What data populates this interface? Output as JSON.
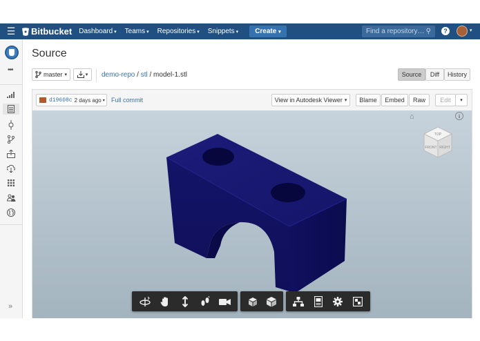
{
  "topnav": {
    "brand": "Bitbucket",
    "menus": [
      "Dashboard",
      "Teams",
      "Repositories",
      "Snippets"
    ],
    "create_label": "Create",
    "search_placeholder": "Find a repository…",
    "help_label": "?"
  },
  "sidebar": {
    "more_label": "•••",
    "collapse_label": "»"
  },
  "page": {
    "title": "Source"
  },
  "branch": {
    "label": "master"
  },
  "breadcrumb": {
    "repo": "demo-repo",
    "separator": " / ",
    "folder": "stl",
    "file": "model-1.stl"
  },
  "view_tabs": [
    "Source",
    "Diff",
    "History"
  ],
  "file_header": {
    "commit_hash": "d19608c",
    "commit_age": "2 days ago",
    "full_commit_label": "Full commit",
    "viewer_select": "View in Autodesk Viewer",
    "actions": [
      "Blame",
      "Embed",
      "Raw"
    ],
    "edit_label": "Edit"
  },
  "viewer": {
    "info_label": "i",
    "viewcube_faces": [
      "TOP",
      "FRONT",
      "RIGHT"
    ],
    "model_color": "#1a1a6e"
  },
  "toolbar": {
    "groups": [
      [
        "orbit-icon",
        "pan-icon",
        "zoom-icon",
        "walk-icon",
        "camera-icon"
      ],
      [
        "explode-icon",
        "model-browser-icon"
      ],
      [
        "structure-icon",
        "properties-icon",
        "settings-icon",
        "fullscreen-icon"
      ]
    ]
  },
  "colors": {
    "nav_bg": "#205081",
    "link": "#3572b0",
    "model": "#1a1a6e"
  }
}
